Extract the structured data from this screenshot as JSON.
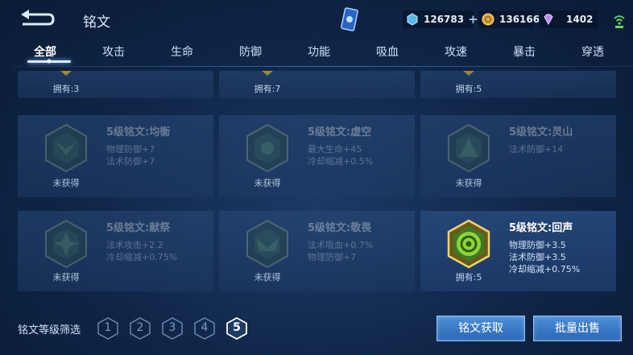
{
  "header": {
    "title": "铭文",
    "currency": [
      {
        "icon": "crystal-icon",
        "value": "126783"
      },
      {
        "icon": "gold-coin-icon",
        "value": "136166"
      },
      {
        "icon": "diamond-icon",
        "value": "1402"
      }
    ],
    "plus": "+"
  },
  "tabs": [
    "全部",
    "攻击",
    "生命",
    "防御",
    "功能",
    "吸血",
    "攻速",
    "暴击",
    "穿透"
  ],
  "active_tab": "全部",
  "cards_top": [
    {
      "owned": "拥有:3"
    },
    {
      "owned": "拥有:7"
    },
    {
      "owned": "拥有:5"
    }
  ],
  "cards": [
    {
      "name": "5级铭文:均衡",
      "attrs": [
        "物理防御+7",
        "法术防御+7"
      ],
      "owned": "未获得",
      "obtained": false
    },
    {
      "name": "5级铭文:虚空",
      "attrs": [
        "最大生命+45",
        "冷却缩减+0.5%"
      ],
      "owned": "未获得",
      "obtained": false
    },
    {
      "name": "5级铭文:灵山",
      "attrs": [
        "法术防御+14"
      ],
      "owned": "未获得",
      "obtained": false
    },
    {
      "name": "5级铭文:献祭",
      "attrs": [
        "法术攻击+2.2",
        "冷却缩减+0.75%"
      ],
      "owned": "未获得",
      "obtained": false
    },
    {
      "name": "5级铭文:敬畏",
      "attrs": [
        "法术吸血+0.7%",
        "物理防御+7"
      ],
      "owned": "未获得",
      "obtained": false
    },
    {
      "name": "5级铭文:回声",
      "attrs": [
        "物理防御+3.5",
        "法术防御+3.5",
        "冷却缩减+0.75%"
      ],
      "owned": "拥有:5",
      "obtained": true
    }
  ],
  "filter": {
    "label": "铭文等级筛选",
    "levels": [
      "1",
      "2",
      "3",
      "4",
      "5"
    ],
    "selected": "5"
  },
  "buttons": {
    "obtain": "铭文获取",
    "sell": "批量出售"
  }
}
